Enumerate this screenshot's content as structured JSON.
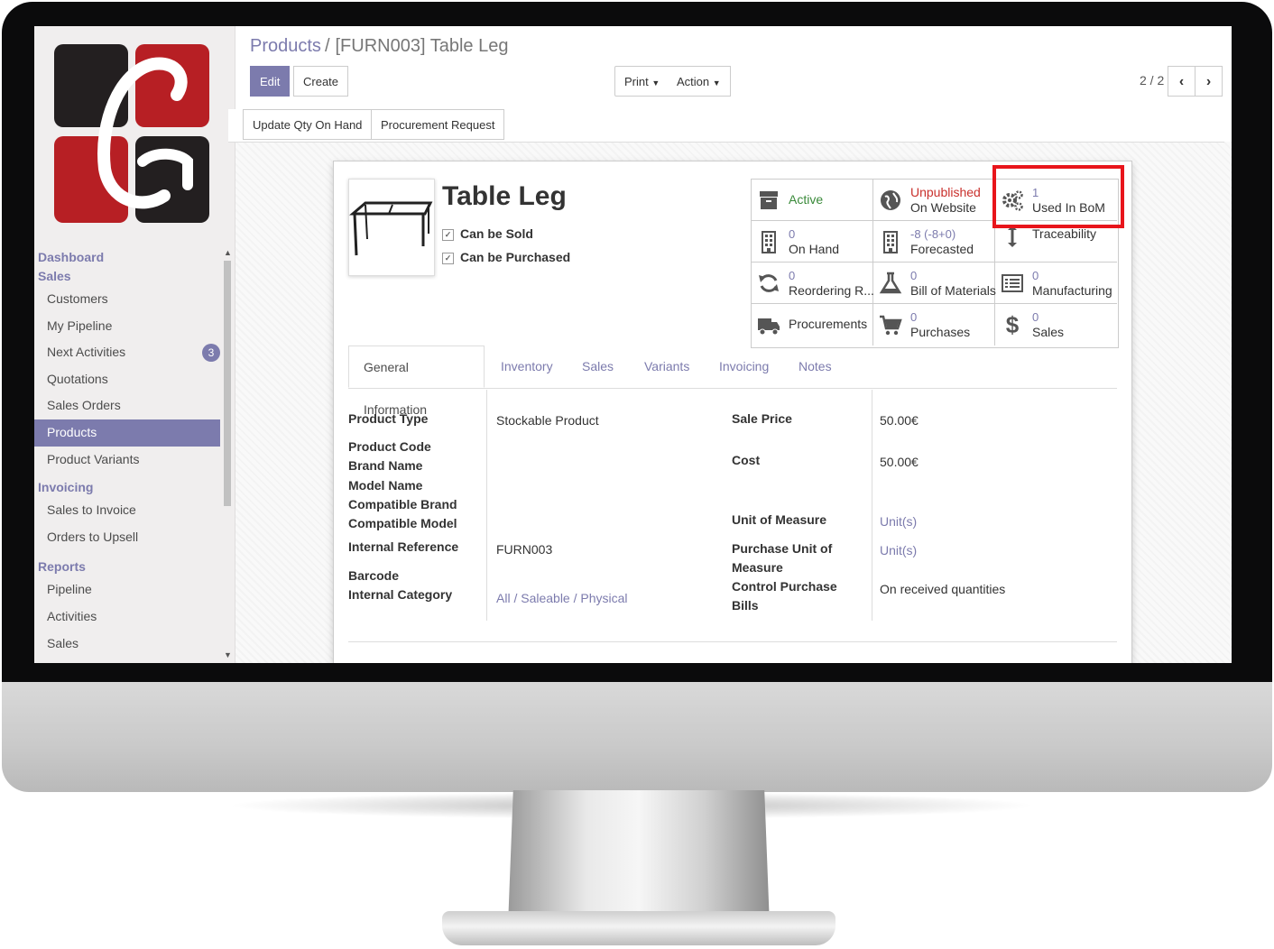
{
  "breadcrumb": {
    "parent": "Products",
    "separator": "/",
    "current": "[FURN003] Table Leg"
  },
  "buttons": {
    "edit": "Edit",
    "create": "Create",
    "print": "Print",
    "action": "Action"
  },
  "pager": {
    "value": "2 / 2"
  },
  "header_buttons": {
    "update_qty": "Update Qty On Hand",
    "procurement": "Procurement Request"
  },
  "sidebar": {
    "sections": {
      "dashboard": "Dashboard",
      "sales": "Sales",
      "invoicing": "Invoicing",
      "reports": "Reports"
    },
    "sales_items": [
      "Customers",
      "My Pipeline",
      "Next Activities",
      "Quotations",
      "Sales Orders",
      "Products",
      "Product Variants"
    ],
    "next_activities_badge": "3",
    "active_item": "Products",
    "invoicing_items": [
      "Sales to Invoice",
      "Orders to Upsell"
    ],
    "reports_items": [
      "Pipeline",
      "Activities",
      "Sales"
    ]
  },
  "product": {
    "name": "Table Leg",
    "can_be_sold": "Can be Sold",
    "can_be_purchased": "Can be Purchased"
  },
  "smart_buttons": {
    "active": {
      "label": "Active",
      "icon": "archive-icon",
      "color": "#3a8a3a"
    },
    "website": {
      "line1": "Unpublished",
      "line2": "On Website",
      "icon": "globe-icon",
      "color": "#c9302c"
    },
    "bom_used": {
      "value": "1",
      "label": "Used In BoM",
      "icon": "gears-icon"
    },
    "on_hand": {
      "value": "0",
      "label": "On Hand",
      "icon": "building-icon"
    },
    "forecasted": {
      "value": "-8 (-8+0)",
      "label": "Forecasted",
      "icon": "building-icon"
    },
    "traceability": {
      "label": "Traceability",
      "icon": "arrows-v-icon"
    },
    "reordering": {
      "value": "0",
      "label": "Reordering R...",
      "icon": "refresh-icon"
    },
    "bom": {
      "value": "0",
      "label": "Bill of Materials",
      "icon": "flask-icon"
    },
    "manufacturing": {
      "value": "0",
      "label": "Manufacturing",
      "icon": "list-icon"
    },
    "procurements": {
      "label": "Procurements",
      "icon": "truck-icon"
    },
    "purchases": {
      "value": "0",
      "label": "Purchases",
      "icon": "cart-icon"
    },
    "sales": {
      "value": "0",
      "label": "Sales",
      "icon": "dollar-icon"
    }
  },
  "tabs": [
    "General Information",
    "Inventory",
    "Sales",
    "Variants",
    "Invoicing",
    "Notes"
  ],
  "fields": {
    "product_type": {
      "label": "Product Type",
      "value": "Stockable Product"
    },
    "product_code": {
      "label": "Product Code"
    },
    "brand_name": {
      "label": "Brand Name"
    },
    "model_name": {
      "label": "Model Name"
    },
    "compatible_brand": {
      "label": "Compatible Brand"
    },
    "compatible_model": {
      "label": "Compatible Model"
    },
    "internal_reference": {
      "label": "Internal Reference",
      "value": "FURN003"
    },
    "barcode": {
      "label": "Barcode"
    },
    "internal_category": {
      "label": "Internal Category",
      "value": "All / Saleable / Physical"
    },
    "sale_price": {
      "label": "Sale Price",
      "value": "50.00€"
    },
    "cost": {
      "label": "Cost",
      "value": "50.00€"
    },
    "uom": {
      "label": "Unit of Measure",
      "value": "Unit(s)"
    },
    "purchase_uom": {
      "label1": "Purchase Unit of",
      "label2": "Measure",
      "value": "Unit(s)"
    },
    "control_purchase": {
      "label1": "Control Purchase",
      "label2": "Bills",
      "value": "On received quantities"
    }
  }
}
